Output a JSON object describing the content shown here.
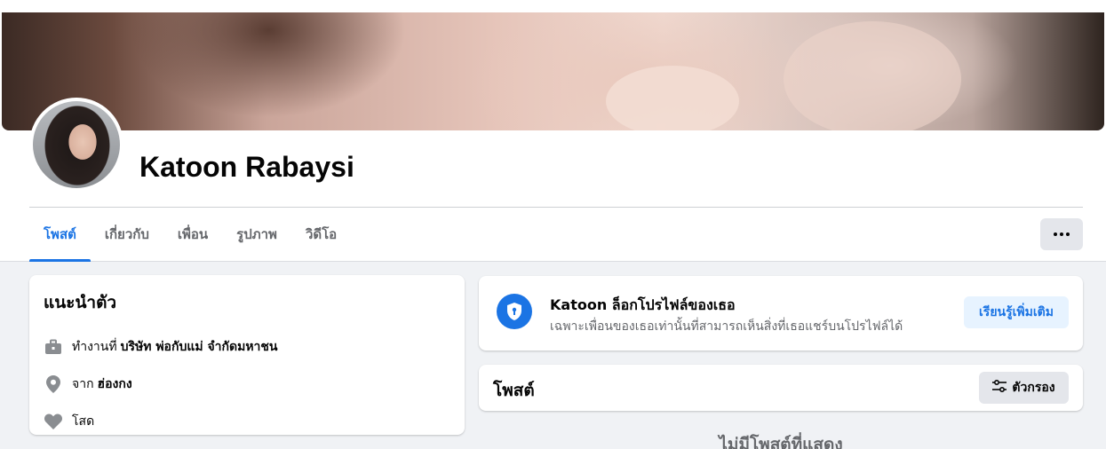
{
  "profile": {
    "name": "Katoon Rabaysi"
  },
  "tabs": [
    {
      "label": "โพสต์",
      "active": true
    },
    {
      "label": "เกี่ยวกับ",
      "active": false
    },
    {
      "label": "เพื่อน",
      "active": false
    },
    {
      "label": "รูปภาพ",
      "active": false
    },
    {
      "label": "วิดีโอ",
      "active": false
    }
  ],
  "intro": {
    "title": "แนะนำตัว",
    "work_prefix": "ทำงานที่",
    "work_value": "บริษัท พ่อกับแม่ จำกัดมหาชน",
    "from_prefix": "จาก",
    "from_value": "ฮ่องกง",
    "relationship": "โสด"
  },
  "lock_notice": {
    "title": "Katoon ล็อกโปรไฟล์ของเธอ",
    "subtitle": "เฉพาะเพื่อนของเธอเท่านั้นที่สามารถเห็นสิ่งที่เธอแชร์บนโปรไฟล์ได้",
    "learn_more": "เรียนรู้เพิ่มเติม"
  },
  "posts": {
    "title": "โพสต์",
    "filter_label": "ตัวกรอง",
    "empty_text": "ไม่มีโพสต์ที่แสดง"
  },
  "colors": {
    "accent": "#1b74e4",
    "background": "#f0f2f5",
    "secondary_text": "#65676b"
  },
  "icons": [
    "more-icon",
    "briefcase-icon",
    "location-pin-icon",
    "heart-icon",
    "shield-lock-icon",
    "filter-sliders-icon"
  ]
}
